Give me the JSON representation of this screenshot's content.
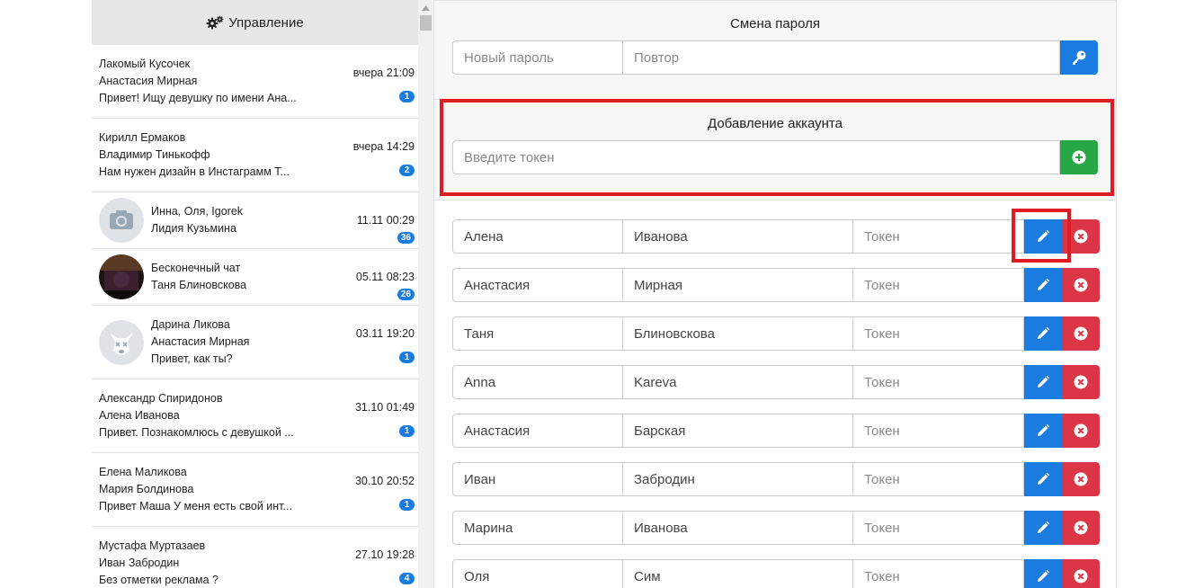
{
  "sidebar": {
    "title": "Управление",
    "dialogs": [
      {
        "line1": "Лакомый Кусочек",
        "line2": "Анастасия Мирная",
        "line3": "Привет! Ищу девушку по имени Ана...",
        "time": "вчера 21:09",
        "badge": "1",
        "avatar": "none"
      },
      {
        "line1": "Кирилл Ермаков",
        "line2": "Владимир Тинькофф",
        "line3": "Нам нужен дизайн в Инстаграмм Т...",
        "time": "вчера 14:29",
        "badge": "2",
        "avatar": "none"
      },
      {
        "line1": "Инна, Оля, Igorek",
        "line2": "Лидия Кузьмина",
        "line3": "",
        "time": "11.11 00:29",
        "badge": "36",
        "avatar": "camera"
      },
      {
        "line1": "Бесконечный чат",
        "line2": "Таня Блиновскова",
        "line3": "",
        "time": "05.11 08:23",
        "badge": "26",
        "avatar": "photo"
      },
      {
        "line1": "Дарина Ликова",
        "line2": "Анастасия Мирная",
        "line3": "Привет, как ты?",
        "time": "03.11 19:20",
        "badge": "1",
        "avatar": "deactivated"
      },
      {
        "line1": "Александр Спиридонов",
        "line2": "Алена Иванова",
        "line3": "Привет. Познакомлюсь с девушкой ...",
        "time": "31.10 01:49",
        "badge": "1",
        "avatar": "none"
      },
      {
        "line1": "Елена Маликова",
        "line2": "Мария Болдинова",
        "line3": "Привет Маша У меня есть свой инт...",
        "time": "30.10 20:52",
        "badge": "1",
        "avatar": "none"
      },
      {
        "line1": "Мустафа Муртазаев",
        "line2": "Иван Забродин",
        "line3": "Без отметки реклама ?",
        "time": "27.10 19:28",
        "badge": "4",
        "avatar": "none"
      }
    ]
  },
  "password": {
    "title": "Смена пароля",
    "new_placeholder": "Новый пароль",
    "repeat_placeholder": "Повтор"
  },
  "add_account": {
    "title": "Добавление аккаунта",
    "token_placeholder": "Введите токен"
  },
  "accounts": [
    {
      "first": "Алена",
      "last": "Иванова",
      "token": "Токен"
    },
    {
      "first": "Анастасия",
      "last": "Мирная",
      "token": "Токен"
    },
    {
      "first": "Таня",
      "last": "Блиновскова",
      "token": "Токен"
    },
    {
      "first": "Anna",
      "last": "Kareva",
      "token": "Токен"
    },
    {
      "first": "Анастасия",
      "last": "Барская",
      "token": "Токен"
    },
    {
      "first": "Иван",
      "last": "Забродин",
      "token": "Токен"
    },
    {
      "first": "Марина",
      "last": "Иванова",
      "token": "Токен"
    },
    {
      "first": "Оля",
      "last": "Сим",
      "token": "Токен"
    }
  ],
  "colors": {
    "primary": "#1a7be0",
    "success": "#28a745",
    "danger": "#dc3545",
    "highlight": "#e01b24"
  }
}
